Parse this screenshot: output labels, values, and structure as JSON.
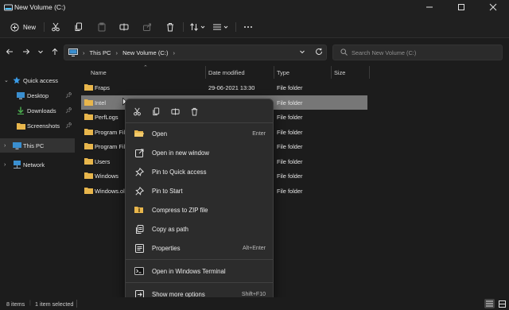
{
  "window": {
    "title": "New Volume (C:)"
  },
  "toolbar": {
    "new_label": "New"
  },
  "address": {
    "segments": [
      "This PC",
      "New Volume (C:)"
    ]
  },
  "search": {
    "placeholder": "Search New Volume (C:)"
  },
  "nav": {
    "items": [
      {
        "label": "Quick access"
      },
      {
        "label": "Desktop"
      },
      {
        "label": "Downloads"
      },
      {
        "label": "Screenshots"
      },
      {
        "label": "This PC"
      },
      {
        "label": "Network"
      }
    ]
  },
  "columns": {
    "name": "Name",
    "date": "Date modified",
    "type": "Type",
    "size": "Size"
  },
  "files": [
    {
      "name": "Fraps",
      "date": "29-06-2021 13:30",
      "type": "File folder"
    },
    {
      "name": "Intel",
      "date": "",
      "type": "File folder"
    },
    {
      "name": "PerfLogs",
      "date": "",
      "type": "File folder"
    },
    {
      "name": "Program File",
      "date": "",
      "type": "File folder"
    },
    {
      "name": "Program File",
      "date": "",
      "type": "File folder"
    },
    {
      "name": "Users",
      "date": "",
      "type": "File folder"
    },
    {
      "name": "Windows",
      "date": "",
      "type": "File folder"
    },
    {
      "name": "Windows.old",
      "date": "",
      "type": "File folder"
    }
  ],
  "context_menu": {
    "items": [
      {
        "label": "Open",
        "shortcut": "Enter"
      },
      {
        "label": "Open in new window",
        "shortcut": ""
      },
      {
        "label": "Pin to Quick access",
        "shortcut": ""
      },
      {
        "label": "Pin to Start",
        "shortcut": ""
      },
      {
        "label": "Compress to ZIP file",
        "shortcut": ""
      },
      {
        "label": "Copy as path",
        "shortcut": ""
      },
      {
        "label": "Properties",
        "shortcut": "Alt+Enter"
      },
      {
        "label": "Open in Windows Terminal",
        "shortcut": ""
      },
      {
        "label": "Show more options",
        "shortcut": "Shift+F10"
      }
    ]
  },
  "status": {
    "items_count": "8 items",
    "selected": "1 item selected"
  },
  "colors": {
    "accent": "#4cc2ff",
    "folder": "#e8b64c",
    "selected_row": "#777777"
  }
}
